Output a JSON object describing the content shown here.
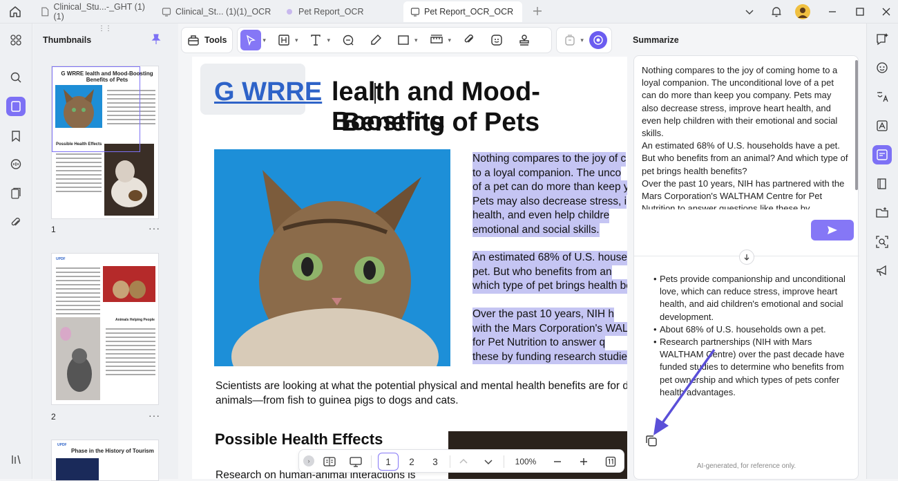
{
  "tabs": [
    {
      "label": "Clinical_Stu...-_GHT (1)(1)"
    },
    {
      "label": "Clinical_St... (1)(1)_OCR"
    },
    {
      "label": "Pet Report_OCR"
    },
    {
      "label": "Pet Report_OCR_OCR"
    }
  ],
  "thumbnails": {
    "title": "Thumbnails",
    "pages": [
      {
        "num": "1"
      },
      {
        "num": "2"
      }
    ],
    "more": "···",
    "p1": {
      "title": "G WRRE lealth and Mood-Boosting Benefits of Pets",
      "h": "Possible Health Effects"
    },
    "p2": {
      "h": "Animals Helping People",
      "logo": "UPDF"
    },
    "p3": {
      "title": "Phase in the History of Tourism",
      "logo": "UPDF"
    }
  },
  "toolbar": {
    "tools_label": "Tools"
  },
  "document": {
    "ocr_word": "G WRRE",
    "title_line1": "lealth and Mood-Boosting",
    "title_line2": "Benefits of Pets",
    "para1": [
      "Nothing compares to the joy of c",
      "to a loyal companion. The unco",
      "of a pet can do more than keep y",
      "Pets may also decrease stress, i",
      "health, and even help childre",
      "emotional and social skills."
    ],
    "para2": [
      "An estimated 68% of U.S. house",
      "pet. But who benefits from an",
      "which type of pet brings health be"
    ],
    "para3": [
      "Over the past 10 years, NIH h",
      "with the Mars Corporation's WAL",
      "for Pet Nutrition to answer q",
      "these by funding research studie"
    ],
    "body1": "Scientists are looking at what the potential physical and mental health benefits are for dif",
    "body2": "animals—from fish to guinea pigs to dogs and cats.",
    "heading2": "Possible Health Effects",
    "body3": "Research on human-animal interactions is"
  },
  "pager": {
    "pages": [
      "1",
      "2",
      "3"
    ],
    "zoom": "100%"
  },
  "summarize": {
    "title": "Summarize",
    "input": "Nothing compares to the joy of coming home to a loyal companion. The unconditional love of a pet can do more than keep you company. Pets may also decrease stress, improve heart health, and even help children with their emotional and social skills.\nAn estimated 68% of U.S. households have a pet. But who benefits from an animal? And which type of pet brings health benefits?\nOver the past 10 years, NIH has partnered with the Mars Corporation's WALTHAM Centre for Pet Nutrition to answer questions like these by",
    "bullets": [
      "Pets provide companionship and unconditional love, which can reduce stress, improve heart health, and aid children's emotional and social development.",
      "About 68% of U.S. households own a pet.",
      "Research partnerships (NIH with Mars WALTHAM Centre) over the past decade have funded studies to determine who benefits from pet ownership and which types of pets confer health advantages."
    ],
    "footer": "AI-generated, for reference only."
  },
  "colors": {
    "accent": "#8577f6",
    "highlight": "#c5c5f3",
    "ocr_blue": "#2e63c8"
  }
}
